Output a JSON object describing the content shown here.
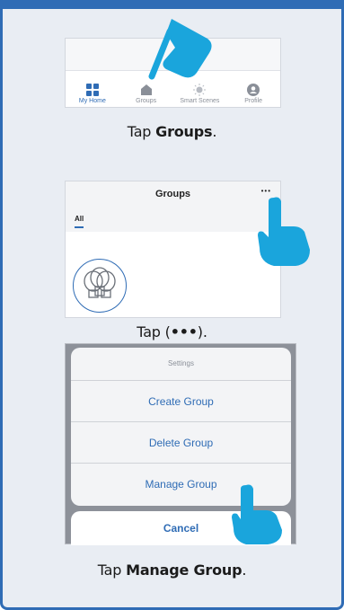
{
  "panel1": {
    "nav": [
      {
        "label": "My Home",
        "icon": "grid-icon",
        "active": true
      },
      {
        "label": "Groups",
        "icon": "home-icon",
        "active": false
      },
      {
        "label": "Smart Scenes",
        "icon": "sun-icon",
        "active": false
      },
      {
        "label": "Profile",
        "icon": "profile-icon",
        "active": false
      }
    ],
    "caption_pre": "Tap ",
    "caption_bold": "Groups",
    "caption_post": "."
  },
  "panel2": {
    "title": "Groups",
    "more": "•••",
    "tab": "All",
    "caption_pre": "Tap (",
    "caption_bold": "•••",
    "caption_post": ")."
  },
  "panel3": {
    "header": "Settings",
    "options": [
      "Create Group",
      "Delete Group",
      "Manage Group"
    ],
    "cancel": "Cancel",
    "caption_pre": "Tap ",
    "caption_bold": "Manage Group",
    "caption_post": "."
  },
  "colors": {
    "accent": "#2f6cb5",
    "hand": "#1aa5dc"
  }
}
